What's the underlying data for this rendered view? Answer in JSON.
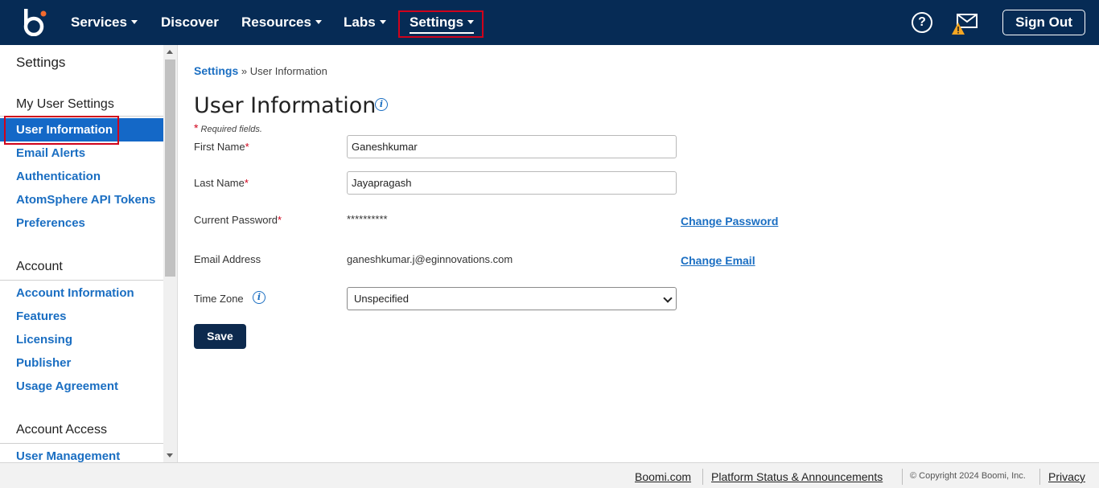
{
  "nav": {
    "items": [
      {
        "label": "Services",
        "has_menu": true
      },
      {
        "label": "Discover",
        "has_menu": false
      },
      {
        "label": "Resources",
        "has_menu": true
      },
      {
        "label": "Labs",
        "has_menu": true
      },
      {
        "label": "Settings",
        "has_menu": true,
        "active": true
      }
    ],
    "help_icon": "question-circle-icon",
    "mail_icon": "envelope-warning-icon",
    "sign_out_label": "Sign Out",
    "background_color": "#062b55"
  },
  "sidebar": {
    "title": "Settings",
    "sections": [
      {
        "heading": "My User Settings",
        "items": [
          "User Information",
          "Email Alerts",
          "Authentication",
          "AtomSphere API Tokens",
          "Preferences"
        ]
      },
      {
        "heading": "Account",
        "items": [
          "Account Information",
          "Features",
          "Licensing",
          "Publisher",
          "Usage Agreement"
        ]
      },
      {
        "heading": "Account Access",
        "items": [
          "User Management"
        ]
      }
    ],
    "active_item": "User Information",
    "active_color": "#1468c7"
  },
  "main": {
    "breadcrumb": {
      "root": "Settings",
      "separator": " » ",
      "current": "User Information"
    },
    "title": "User Information",
    "required_star": "*",
    "required_note": "Required fields.",
    "fields": {
      "first_name": {
        "label": "First Name",
        "value": "Ganeshkumar"
      },
      "last_name": {
        "label": "Last Name",
        "value": "Jayapragash"
      },
      "current_password": {
        "label": "Current Password",
        "value": "**********",
        "action": "Change Password"
      },
      "email": {
        "label": "Email Address",
        "value": "ganeshkumar.j@eginnovations.com",
        "action": "Change Email"
      },
      "time_zone": {
        "label": "Time Zone",
        "value": "Unspecified"
      }
    },
    "save_label": "Save"
  },
  "footer": {
    "links": [
      "Boomi.com",
      "Platform Status & Announcements"
    ],
    "copyright": "© Copyright 2024 Boomi, Inc.",
    "privacy": "Privacy"
  }
}
